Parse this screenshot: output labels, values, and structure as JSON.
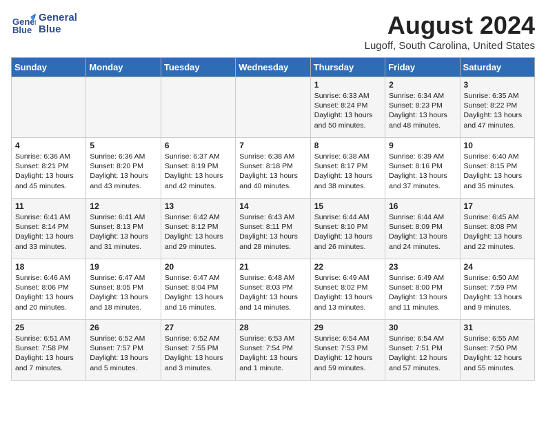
{
  "logo": {
    "line1": "General",
    "line2": "Blue"
  },
  "title": "August 2024",
  "location": "Lugoff, South Carolina, United States",
  "days_of_week": [
    "Sunday",
    "Monday",
    "Tuesday",
    "Wednesday",
    "Thursday",
    "Friday",
    "Saturday"
  ],
  "weeks": [
    [
      {
        "day": "",
        "info": ""
      },
      {
        "day": "",
        "info": ""
      },
      {
        "day": "",
        "info": ""
      },
      {
        "day": "",
        "info": ""
      },
      {
        "day": "1",
        "info": "Sunrise: 6:33 AM\nSunset: 8:24 PM\nDaylight: 13 hours and 50 minutes."
      },
      {
        "day": "2",
        "info": "Sunrise: 6:34 AM\nSunset: 8:23 PM\nDaylight: 13 hours and 48 minutes."
      },
      {
        "day": "3",
        "info": "Sunrise: 6:35 AM\nSunset: 8:22 PM\nDaylight: 13 hours and 47 minutes."
      }
    ],
    [
      {
        "day": "4",
        "info": "Sunrise: 6:36 AM\nSunset: 8:21 PM\nDaylight: 13 hours and 45 minutes."
      },
      {
        "day": "5",
        "info": "Sunrise: 6:36 AM\nSunset: 8:20 PM\nDaylight: 13 hours and 43 minutes."
      },
      {
        "day": "6",
        "info": "Sunrise: 6:37 AM\nSunset: 8:19 PM\nDaylight: 13 hours and 42 minutes."
      },
      {
        "day": "7",
        "info": "Sunrise: 6:38 AM\nSunset: 8:18 PM\nDaylight: 13 hours and 40 minutes."
      },
      {
        "day": "8",
        "info": "Sunrise: 6:38 AM\nSunset: 8:17 PM\nDaylight: 13 hours and 38 minutes."
      },
      {
        "day": "9",
        "info": "Sunrise: 6:39 AM\nSunset: 8:16 PM\nDaylight: 13 hours and 37 minutes."
      },
      {
        "day": "10",
        "info": "Sunrise: 6:40 AM\nSunset: 8:15 PM\nDaylight: 13 hours and 35 minutes."
      }
    ],
    [
      {
        "day": "11",
        "info": "Sunrise: 6:41 AM\nSunset: 8:14 PM\nDaylight: 13 hours and 33 minutes."
      },
      {
        "day": "12",
        "info": "Sunrise: 6:41 AM\nSunset: 8:13 PM\nDaylight: 13 hours and 31 minutes."
      },
      {
        "day": "13",
        "info": "Sunrise: 6:42 AM\nSunset: 8:12 PM\nDaylight: 13 hours and 29 minutes."
      },
      {
        "day": "14",
        "info": "Sunrise: 6:43 AM\nSunset: 8:11 PM\nDaylight: 13 hours and 28 minutes."
      },
      {
        "day": "15",
        "info": "Sunrise: 6:44 AM\nSunset: 8:10 PM\nDaylight: 13 hours and 26 minutes."
      },
      {
        "day": "16",
        "info": "Sunrise: 6:44 AM\nSunset: 8:09 PM\nDaylight: 13 hours and 24 minutes."
      },
      {
        "day": "17",
        "info": "Sunrise: 6:45 AM\nSunset: 8:08 PM\nDaylight: 13 hours and 22 minutes."
      }
    ],
    [
      {
        "day": "18",
        "info": "Sunrise: 6:46 AM\nSunset: 8:06 PM\nDaylight: 13 hours and 20 minutes."
      },
      {
        "day": "19",
        "info": "Sunrise: 6:47 AM\nSunset: 8:05 PM\nDaylight: 13 hours and 18 minutes."
      },
      {
        "day": "20",
        "info": "Sunrise: 6:47 AM\nSunset: 8:04 PM\nDaylight: 13 hours and 16 minutes."
      },
      {
        "day": "21",
        "info": "Sunrise: 6:48 AM\nSunset: 8:03 PM\nDaylight: 13 hours and 14 minutes."
      },
      {
        "day": "22",
        "info": "Sunrise: 6:49 AM\nSunset: 8:02 PM\nDaylight: 13 hours and 13 minutes."
      },
      {
        "day": "23",
        "info": "Sunrise: 6:49 AM\nSunset: 8:00 PM\nDaylight: 13 hours and 11 minutes."
      },
      {
        "day": "24",
        "info": "Sunrise: 6:50 AM\nSunset: 7:59 PM\nDaylight: 13 hours and 9 minutes."
      }
    ],
    [
      {
        "day": "25",
        "info": "Sunrise: 6:51 AM\nSunset: 7:58 PM\nDaylight: 13 hours and 7 minutes."
      },
      {
        "day": "26",
        "info": "Sunrise: 6:52 AM\nSunset: 7:57 PM\nDaylight: 13 hours and 5 minutes."
      },
      {
        "day": "27",
        "info": "Sunrise: 6:52 AM\nSunset: 7:55 PM\nDaylight: 13 hours and 3 minutes."
      },
      {
        "day": "28",
        "info": "Sunrise: 6:53 AM\nSunset: 7:54 PM\nDaylight: 13 hours and 1 minute."
      },
      {
        "day": "29",
        "info": "Sunrise: 6:54 AM\nSunset: 7:53 PM\nDaylight: 12 hours and 59 minutes."
      },
      {
        "day": "30",
        "info": "Sunrise: 6:54 AM\nSunset: 7:51 PM\nDaylight: 12 hours and 57 minutes."
      },
      {
        "day": "31",
        "info": "Sunrise: 6:55 AM\nSunset: 7:50 PM\nDaylight: 12 hours and 55 minutes."
      }
    ]
  ]
}
